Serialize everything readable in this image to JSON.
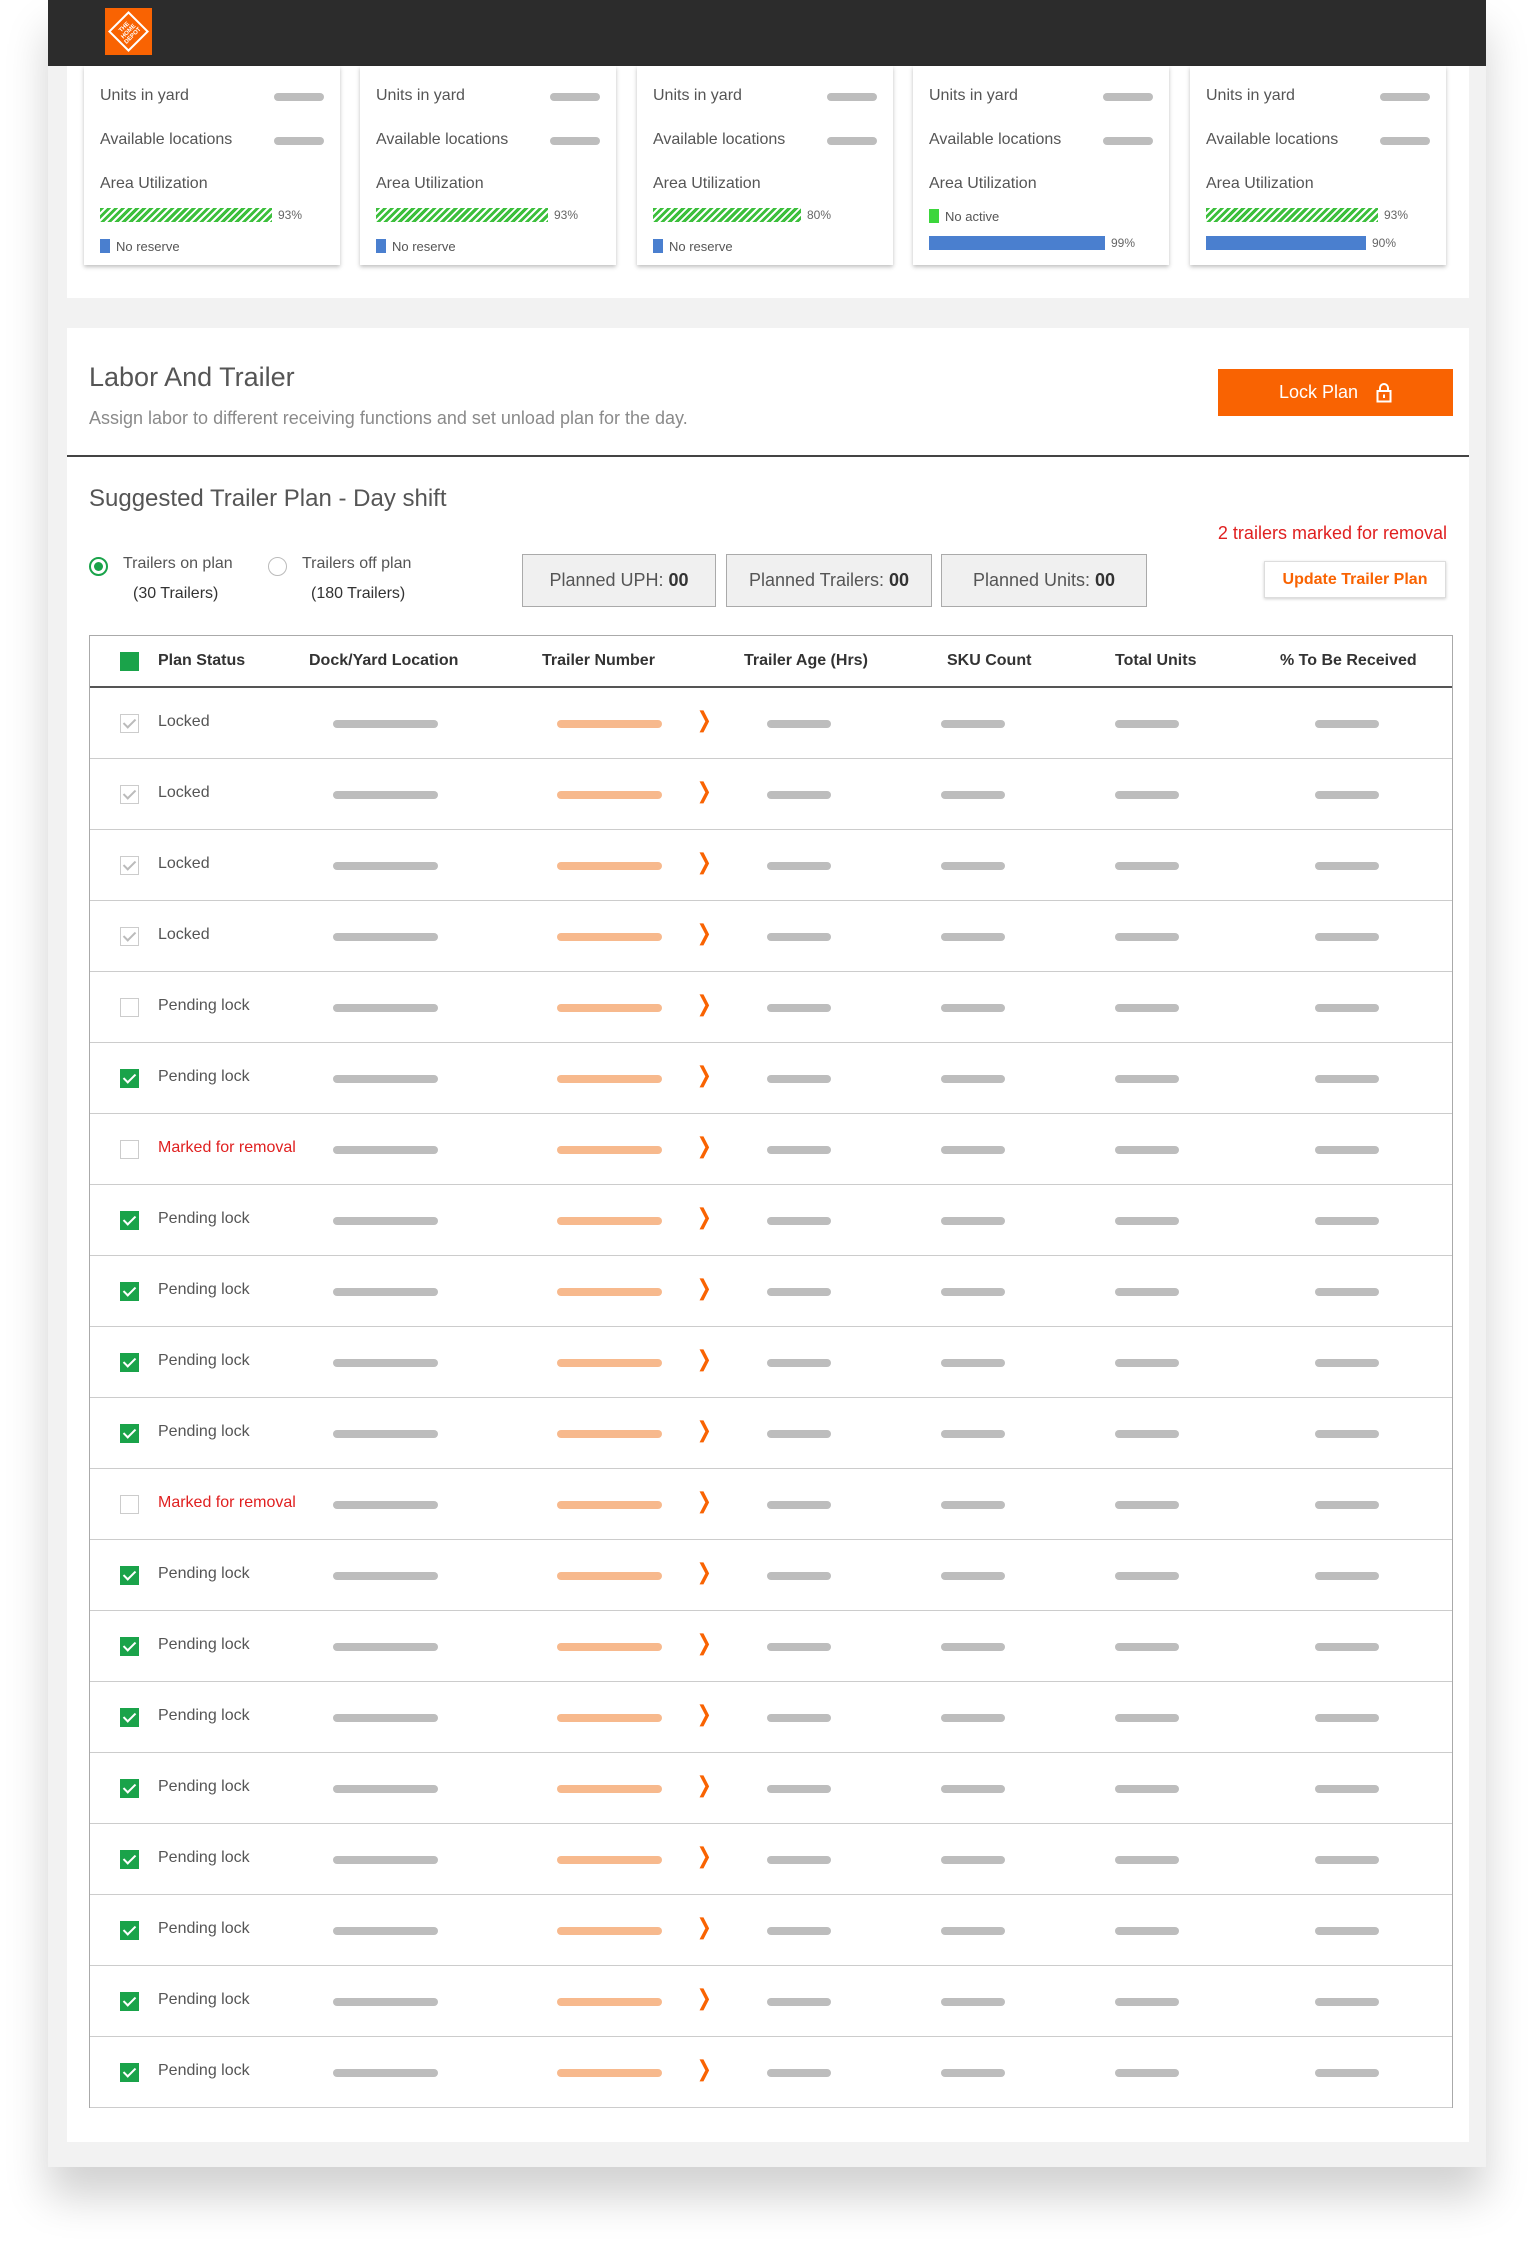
{
  "brand": {
    "logo_text": "THE HOME DEPOT",
    "accent": "#f96302"
  },
  "cards": [
    {
      "units_label": "Units in yard",
      "locations_label": "Available locations",
      "util_label": "Area Utilization",
      "util_pct": "93%",
      "util_value": 93,
      "legend": "No reserve",
      "legend_color": "#4a7fcf",
      "bar_pct": ""
    },
    {
      "units_label": "Units in yard",
      "locations_label": "Available locations",
      "util_label": "Area Utilization",
      "util_pct": "93%",
      "util_value": 93,
      "legend": "No reserve",
      "legend_color": "#4a7fcf",
      "bar_pct": ""
    },
    {
      "units_label": "Units in yard",
      "locations_label": "Available locations",
      "util_label": "Area Utilization",
      "util_pct": "80%",
      "util_value": 80,
      "legend": "No reserve",
      "legend_color": "#4a7fcf",
      "bar_pct": ""
    },
    {
      "units_label": "Units in yard",
      "locations_label": "Available locations",
      "util_label": "Area Utilization",
      "util_pct": "",
      "util_value": 0,
      "legend": "No active",
      "legend_color": "#3cd63c",
      "bar_pct": "99%",
      "bar_value": 99
    },
    {
      "units_label": "Units in yard",
      "locations_label": "Available locations",
      "util_label": "Area Utilization",
      "util_pct": "93%",
      "util_value": 93,
      "legend": "",
      "legend_color": "",
      "bar_pct": "90%",
      "bar_value": 90
    }
  ],
  "section": {
    "title": "Labor And Trailer",
    "subtitle": "Assign labor to different receiving functions and set unload plan for the day.",
    "lock_button": "Lock Plan"
  },
  "plan": {
    "title": "Suggested Trailer Plan - Day shift",
    "removal_note": "2 trailers marked for removal",
    "on_plan_label": "Trailers on plan",
    "on_plan_count": "(30 Trailers)",
    "off_plan_label": "Trailers off plan",
    "off_plan_count": "(180 Trailers)",
    "stats": [
      {
        "label": "Planned UPH:",
        "value": "00"
      },
      {
        "label": "Planned Trailers:",
        "value": "00"
      },
      {
        "label": "Planned Units:",
        "value": "00"
      }
    ],
    "update_button": "Update Trailer Plan"
  },
  "table": {
    "columns": [
      "Plan Status",
      "Dock/Yard Location",
      "Trailer Number",
      "Trailer Age (Hrs)",
      "SKU Count",
      "Total Units",
      "% To Be Received"
    ],
    "rows": [
      {
        "status": "Locked",
        "state": "locked"
      },
      {
        "status": "Locked",
        "state": "locked"
      },
      {
        "status": "Locked",
        "state": "locked"
      },
      {
        "status": "Locked",
        "state": "locked"
      },
      {
        "status": "Pending lock",
        "state": "unchecked"
      },
      {
        "status": "Pending lock",
        "state": "checked"
      },
      {
        "status": "Marked for removal",
        "state": "removal"
      },
      {
        "status": "Pending lock",
        "state": "checked"
      },
      {
        "status": "Pending lock",
        "state": "checked"
      },
      {
        "status": "Pending lock",
        "state": "checked"
      },
      {
        "status": "Pending lock",
        "state": "checked"
      },
      {
        "status": "Marked for removal",
        "state": "removal"
      },
      {
        "status": "Pending lock",
        "state": "checked"
      },
      {
        "status": "Pending lock",
        "state": "checked"
      },
      {
        "status": "Pending lock",
        "state": "checked"
      },
      {
        "status": "Pending lock",
        "state": "checked"
      },
      {
        "status": "Pending lock",
        "state": "checked"
      },
      {
        "status": "Pending lock",
        "state": "checked"
      },
      {
        "status": "Pending lock",
        "state": "checked"
      },
      {
        "status": "Pending lock",
        "state": "checked"
      }
    ]
  }
}
